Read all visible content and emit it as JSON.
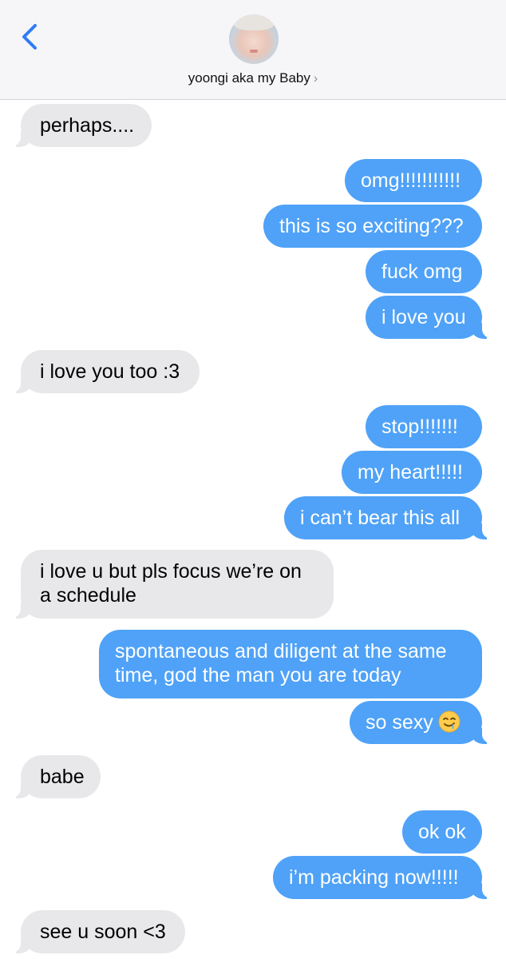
{
  "header": {
    "back_icon": "chevron-left-icon",
    "avatar": "contact-avatar-photo",
    "contact_name": "yoongi aka my Baby",
    "chevron": "›"
  },
  "colors": {
    "incoming_bubble": "#e8e8eb",
    "outgoing_bubble": "#4fa2f7",
    "accent": "#2f7cf6"
  },
  "messages": [
    {
      "from": "them",
      "text": "perhaps...."
    },
    {
      "from": "me",
      "text": "omg!!!!!!!!!!!"
    },
    {
      "from": "me",
      "text": "this is so exciting???"
    },
    {
      "from": "me",
      "text": "fuck omg"
    },
    {
      "from": "me",
      "text": "i love you"
    },
    {
      "from": "them",
      "text": "i love you too :3"
    },
    {
      "from": "me",
      "text": "stop!!!!!!!"
    },
    {
      "from": "me",
      "text": "my heart!!!!!"
    },
    {
      "from": "me",
      "text": "i can’t bear this all"
    },
    {
      "from": "them",
      "text": "i love u but pls focus we’re on a schedule"
    },
    {
      "from": "me",
      "text": "spontaneous and diligent at the same time, god the man you are today"
    },
    {
      "from": "me",
      "text": "so sexy",
      "emoji": "drooling-face-icon"
    },
    {
      "from": "them",
      "text": "babe"
    },
    {
      "from": "me",
      "text": "ok ok"
    },
    {
      "from": "me",
      "text": "i’m packing now!!!!!"
    },
    {
      "from": "them",
      "text": "see u soon <3"
    }
  ]
}
